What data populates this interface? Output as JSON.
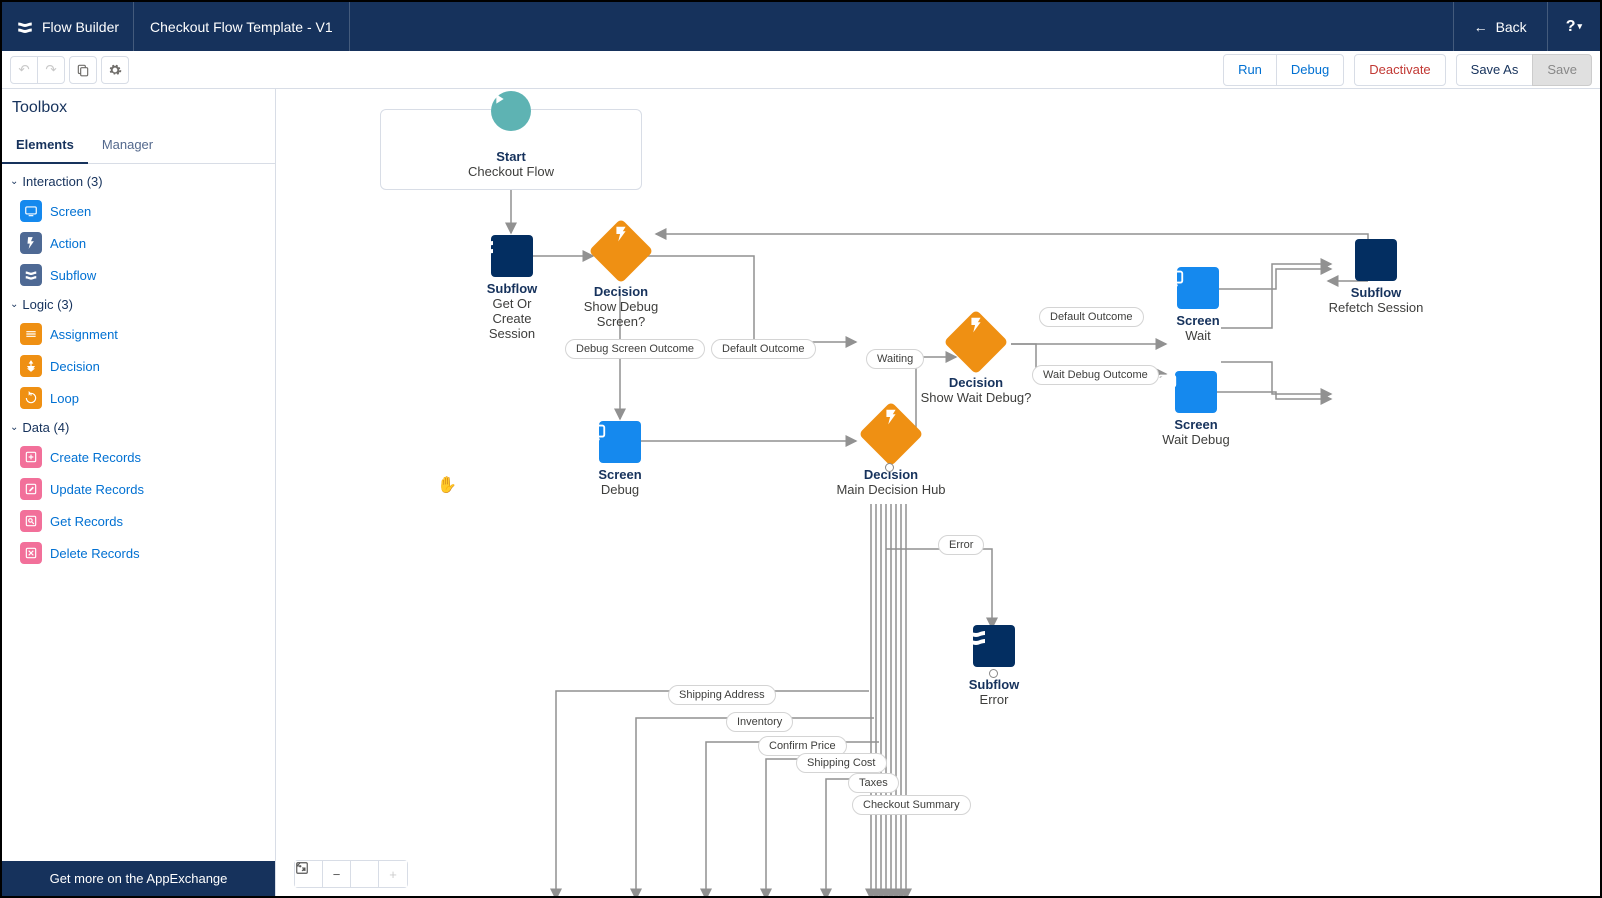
{
  "header": {
    "app": "Flow Builder",
    "title": "Checkout Flow Template - V1",
    "back": "Back",
    "help": "?"
  },
  "toolbar": {
    "run": "Run",
    "debug": "Debug",
    "deactivate": "Deactivate",
    "saveAs": "Save As",
    "save": "Save"
  },
  "sidebar": {
    "title": "Toolbox",
    "tab_elements": "Elements",
    "tab_manager": "Manager",
    "groups": [
      {
        "label": "Interaction (3)",
        "items": [
          {
            "name": "Screen",
            "ic": "ic-blue",
            "icon": "screen"
          },
          {
            "name": "Action",
            "ic": "ic-navy",
            "icon": "bolt"
          },
          {
            "name": "Subflow",
            "ic": "ic-navy",
            "icon": "flow"
          }
        ]
      },
      {
        "label": "Logic (3)",
        "items": [
          {
            "name": "Assignment",
            "ic": "ic-orange",
            "icon": "assign"
          },
          {
            "name": "Decision",
            "ic": "ic-orange",
            "icon": "decision"
          },
          {
            "name": "Loop",
            "ic": "ic-orange",
            "icon": "loop"
          }
        ]
      },
      {
        "label": "Data (4)",
        "items": [
          {
            "name": "Create Records",
            "ic": "ic-pink",
            "icon": "create"
          },
          {
            "name": "Update Records",
            "ic": "ic-pink",
            "icon": "update"
          },
          {
            "name": "Get Records",
            "ic": "ic-pink",
            "icon": "get"
          },
          {
            "name": "Delete Records",
            "ic": "ic-pink",
            "icon": "delete"
          }
        ]
      }
    ],
    "promo": "Get more on the AppExchange"
  },
  "nodes": {
    "start": {
      "title": "Start",
      "sub": "Checkout Flow"
    },
    "subflow1": {
      "title": "Subflow",
      "sub": "Get Or Create Session"
    },
    "dec1": {
      "title": "Decision",
      "sub": "Show Debug Screen?"
    },
    "scrDebug": {
      "title": "Screen",
      "sub": "Debug"
    },
    "dec2": {
      "title": "Decision",
      "sub": "Main Decision Hub"
    },
    "dec3": {
      "title": "Decision",
      "sub": "Show Wait Debug?"
    },
    "scrWait": {
      "title": "Screen",
      "sub": "Wait"
    },
    "scrWaitD": {
      "title": "Screen",
      "sub": "Wait Debug"
    },
    "subflow2": {
      "title": "Subflow",
      "sub": "Refetch Session"
    },
    "subflow3": {
      "title": "Subflow",
      "sub": "Error"
    }
  },
  "pills": {
    "debugOut": "Debug Screen Outcome",
    "defaultOut": "Default Outcome",
    "waiting": "Waiting",
    "defaultOut2": "Default Outcome",
    "waitDebugOut": "Wait Debug Outcome",
    "error": "Error",
    "shipAddr": "Shipping Address",
    "inventory": "Inventory",
    "confirmPrice": "Confirm Price",
    "shipCost": "Shipping Cost",
    "taxes": "Taxes",
    "checkoutSum": "Checkout Summary"
  }
}
